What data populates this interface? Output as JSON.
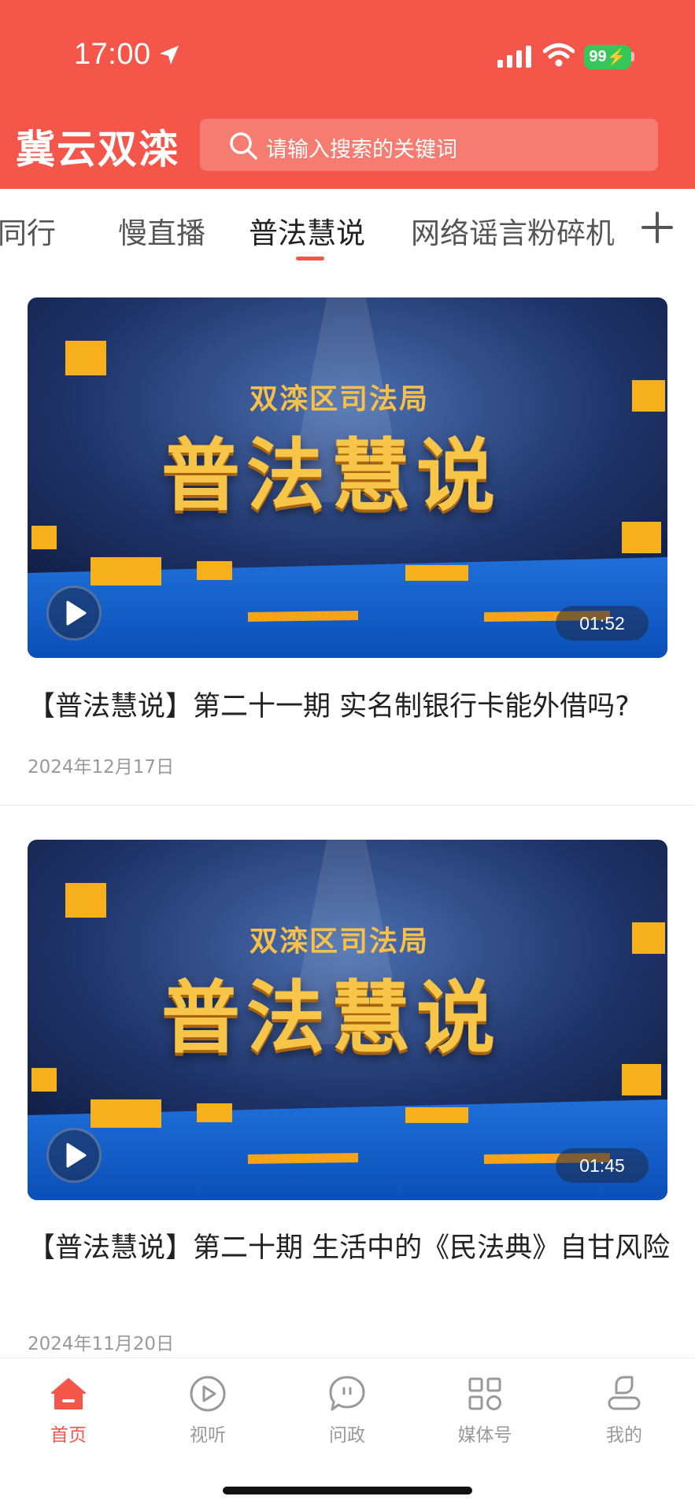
{
  "status_bar": {
    "time": "17:00",
    "battery": "99"
  },
  "header": {
    "app_title": "冀云双滦",
    "search_placeholder": "请输入搜索的关键词"
  },
  "tabs": [
    {
      "label": "我同行"
    },
    {
      "label": "慢直播"
    },
    {
      "label": "普法慧说",
      "active": true
    },
    {
      "label": "网络谣言粉碎机"
    }
  ],
  "thumbnail_text": {
    "subtitle": "双滦区司法局",
    "headline": "普法慧说"
  },
  "articles": [
    {
      "title": "【普法慧说】第二十一期 实名制银行卡能外借吗?",
      "date": "2024年12月17日",
      "duration": "01:52"
    },
    {
      "title": "【普法慧说】第二十期 生活中的《民法典》自甘风险",
      "date": "2024年11月20日",
      "duration": "01:45"
    }
  ],
  "bottom_nav": [
    {
      "label": "首页",
      "icon": "home-icon",
      "active": true
    },
    {
      "label": "视听",
      "icon": "play-circle-icon"
    },
    {
      "label": "问政",
      "icon": "chat-bubble-icon"
    },
    {
      "label": "媒体号",
      "icon": "grid-icon"
    },
    {
      "label": "我的",
      "icon": "user-icon"
    }
  ],
  "colors": {
    "brand_red": "#f4564a",
    "text_main": "#222222",
    "text_muted": "#999999",
    "battery_green": "#35c759"
  }
}
